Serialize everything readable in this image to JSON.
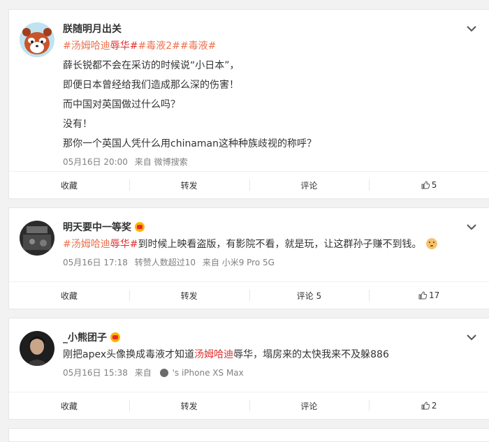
{
  "posts": [
    {
      "username": "朕随明月出关",
      "topics": [
        "#汤姆哈迪",
        "辱华#",
        "#毒液2#",
        "#毒液#"
      ],
      "lines": [
        "薛长锐都不会在采访的时候说“小日本”，",
        "即便日本曾经给我们造成那么深的伤害！",
        "而中国对英国做过什么吗？",
        "没有！",
        "那你一个英国人凭什么用chinaman这种种族歧视的称呼？"
      ],
      "time": "05月16日 20:00",
      "source": "来自 微博搜索",
      "actions": {
        "collect": "收藏",
        "repost": "转发",
        "comment": "评论",
        "like": "5"
      }
    },
    {
      "username": "明天要中一等奖",
      "topic_a": "#汤姆哈迪",
      "topic_b": "辱华#",
      "body": "到时候上映看盗版，有影院不看，就是玩，让这群孙子赚不到钱。",
      "time": "05月16日 17:18",
      "extra": "转赞人数超过10",
      "source": "来自 小米9 Pro 5G",
      "actions": {
        "collect": "收藏",
        "repost": "转发",
        "comment": "评论 5",
        "like": "17"
      }
    },
    {
      "username": "_小熊团子",
      "body_prefix": "刚把apex头像换成毒液才知道",
      "body_highlight": "汤姆哈迪",
      "body_suffix": "辱华，塌房来的太快我来不及躲886",
      "time": "05月16日 15:38",
      "source_prefix": "来自",
      "source_suffix": "'s iPhone XS Max",
      "actions": {
        "collect": "收藏",
        "repost": "转发",
        "comment": "评论",
        "like": "2"
      }
    }
  ],
  "colors": {
    "topic": "#eb7350",
    "highlight": "#e02f2f",
    "meta": "#808080"
  }
}
